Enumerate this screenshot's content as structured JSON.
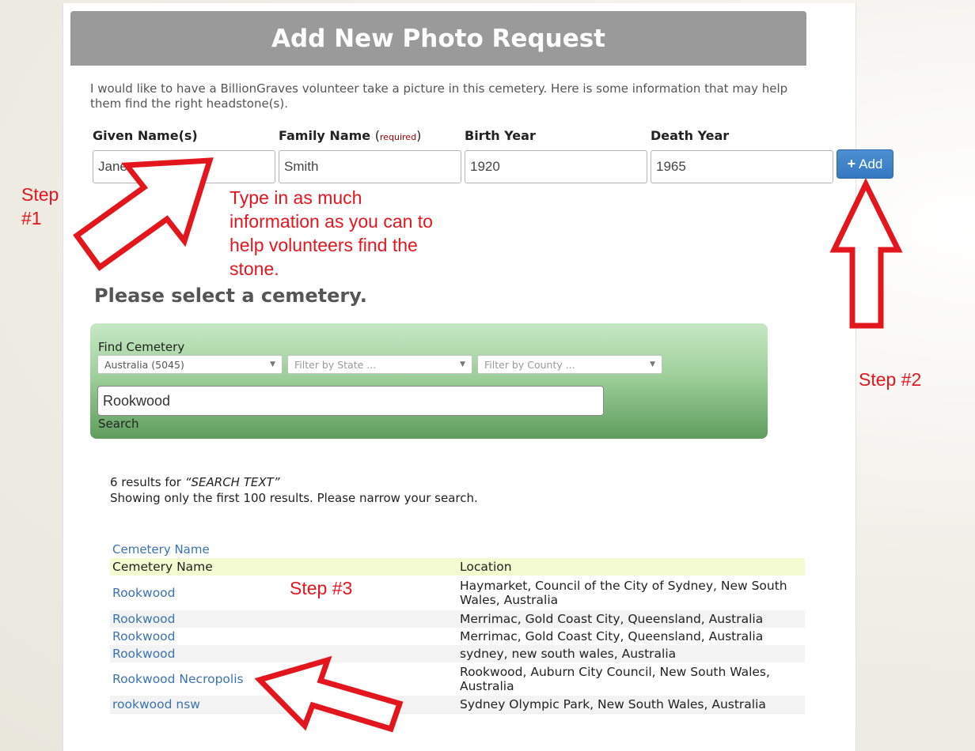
{
  "page": {
    "title": "Add New Photo Request",
    "intro": "I would like to have a BillionGraves volunteer take a picture in this cemetery. Here is some information that may help them find the right headstone(s)."
  },
  "form": {
    "given_label": "Given Name(s)",
    "family_label": "Family Name",
    "family_required": "required",
    "birth_label": "Birth Year",
    "death_label": "Death Year",
    "given_value": "Jane",
    "family_value": "Smith",
    "birth_value": "1920",
    "death_value": "1965",
    "add_label": "Add",
    "add_icon": "plus-icon"
  },
  "annotations": {
    "step1": "Step #1",
    "step1_note": "Type in as much information as you can to help volunteers find the stone.",
    "step2": "Step #2",
    "step3": "Step #3",
    "color": "#e3161e"
  },
  "cemetery": {
    "heading": "Please select a cemetery.",
    "find_label": "Find Cemetery",
    "country_select": "Australia (5045)",
    "state_placeholder": "Filter by State ...",
    "county_placeholder": "Filter by County ...",
    "search_value": "Rookwood",
    "search_label": "Search"
  },
  "results": {
    "count_line": "6 results for",
    "query": "“SEARCH TEXT”",
    "limit_note": "Showing only the first 100 results. Please narrow your search.",
    "sort_link": "Cemetery Name",
    "columns": [
      "Cemetery Name",
      "Location"
    ],
    "rows": [
      {
        "name": "Rookwood",
        "location": "Haymarket, Council of the City of Sydney, New South Wales, Australia"
      },
      {
        "name": "Rookwood",
        "location": "Merrimac, Gold Coast City, Queensland, Australia"
      },
      {
        "name": "Rookwood",
        "location": "Merrimac, Gold Coast City, Queensland, Australia"
      },
      {
        "name": "Rookwood",
        "location": "sydney, new south wales, Australia"
      },
      {
        "name": "Rookwood Necropolis",
        "location": "Rookwood, Auburn City Council, New South Wales, Australia"
      },
      {
        "name": "rookwood nsw",
        "location": "Sydney Olympic Park, New South Wales, Australia"
      }
    ]
  },
  "colors": {
    "title_bar": "#9a9a9a",
    "button": "#3478c2",
    "link": "#3b73b0",
    "header_row": "#f5fbd0",
    "find_box": "#7fb97c"
  }
}
